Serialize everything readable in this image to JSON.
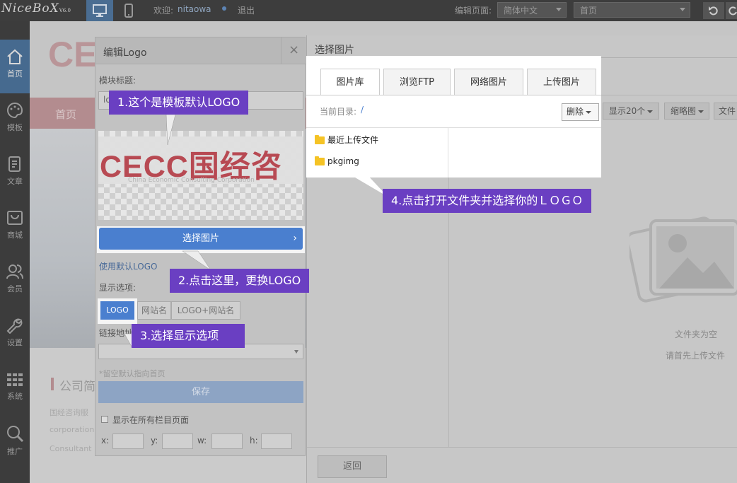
{
  "topbar": {
    "logo_text": "NiceBoX",
    "logo_version": "V6.0",
    "welcome_label": "欢迎:",
    "username": "nitaowa",
    "logout": "退出",
    "edit_page_label": "编辑页面:",
    "language_select": "简体中文",
    "page_select": "首页"
  },
  "sidebar": {
    "items": [
      {
        "label": "首页",
        "icon": "home-icon"
      },
      {
        "label": "模板",
        "icon": "palette-icon"
      },
      {
        "label": "文章",
        "icon": "document-icon"
      },
      {
        "label": "商城",
        "icon": "shop-icon"
      },
      {
        "label": "会员",
        "icon": "users-icon"
      },
      {
        "label": "设置",
        "icon": "wrench-icon"
      },
      {
        "label": "系统",
        "icon": "grid-icon"
      },
      {
        "label": "推广",
        "icon": "search-icon"
      }
    ]
  },
  "site": {
    "brand": "CE",
    "nav_home": "首页",
    "section_title": "公司简",
    "intro_line1": "国经咨询服",
    "intro_line2": "corporation",
    "intro_line3": "Consultant"
  },
  "logo_dialog": {
    "title": "编辑Logo",
    "module_title_label": "模块标题:",
    "module_title_value": "logo",
    "logo_image_text": "CECC国经咨",
    "logo_image_subtext": "China Economic Consulting Corporation",
    "choose_image_button": "选择图片",
    "use_default_link": "使用默认LOGO",
    "display_label": "显示选项:",
    "display_options": [
      "LOGO",
      "网站名",
      "LOGO+网站名"
    ],
    "link_label": "链接地址:",
    "link_hint": "*留空默认指向首页",
    "save_button": "保存",
    "show_all_label": "显示在所有栏目页面",
    "x_label": "x:",
    "y_label": "y:",
    "w_label": "w:",
    "h_label": "h:"
  },
  "image_dialog": {
    "title": "选择图片",
    "tabs": [
      "图片库",
      "浏览FTP",
      "网络图片",
      "上传图片"
    ],
    "current_dir_label": "当前目录:",
    "current_dir_value": "/",
    "delete_button": "删除",
    "show_count_button": "显示20个",
    "thumbnail_button": "缩略图",
    "file_button": "文件",
    "folders": [
      "最近上传文件",
      "pkgimg"
    ],
    "empty_title": "文件夹为空",
    "empty_hint": "请首先上传文件",
    "back_button": "返回"
  },
  "callouts": {
    "c1": "1.这个是模板默认LOGO",
    "c2": "2.点击这里，更换LOGO",
    "c3": "3.选择显示选项",
    "c4": "4.点击打开文件夹并选择你的ＬＯＧＯ"
  },
  "colors": {
    "accent_blue": "#4a7fcf",
    "callout_purple": "#6a3fc2",
    "logo_red": "#b6424c",
    "topbar_dark": "#3d3d3d"
  }
}
